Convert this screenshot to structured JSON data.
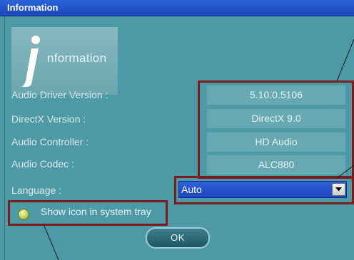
{
  "window": {
    "title": "Information"
  },
  "logo": {
    "text": "nformation"
  },
  "info": {
    "rows": [
      {
        "label": "Audio Driver Version :",
        "value": "5.10.0.5106"
      },
      {
        "label": "DirectX Version :",
        "value": "DirectX 9.0"
      },
      {
        "label": "Audio Controller :",
        "value": "HD Audio"
      },
      {
        "label": "Audio Codec :",
        "value": "ALC880"
      }
    ]
  },
  "language": {
    "label": "Language :",
    "selected": "Auto"
  },
  "tray": {
    "label": "Show icon in system tray",
    "checked": true
  },
  "buttons": {
    "ok": "OK"
  },
  "colors": {
    "background": "#4d9aa6",
    "highlight_frame": "#7a1d1d",
    "select_bg": "#1c45bf"
  }
}
